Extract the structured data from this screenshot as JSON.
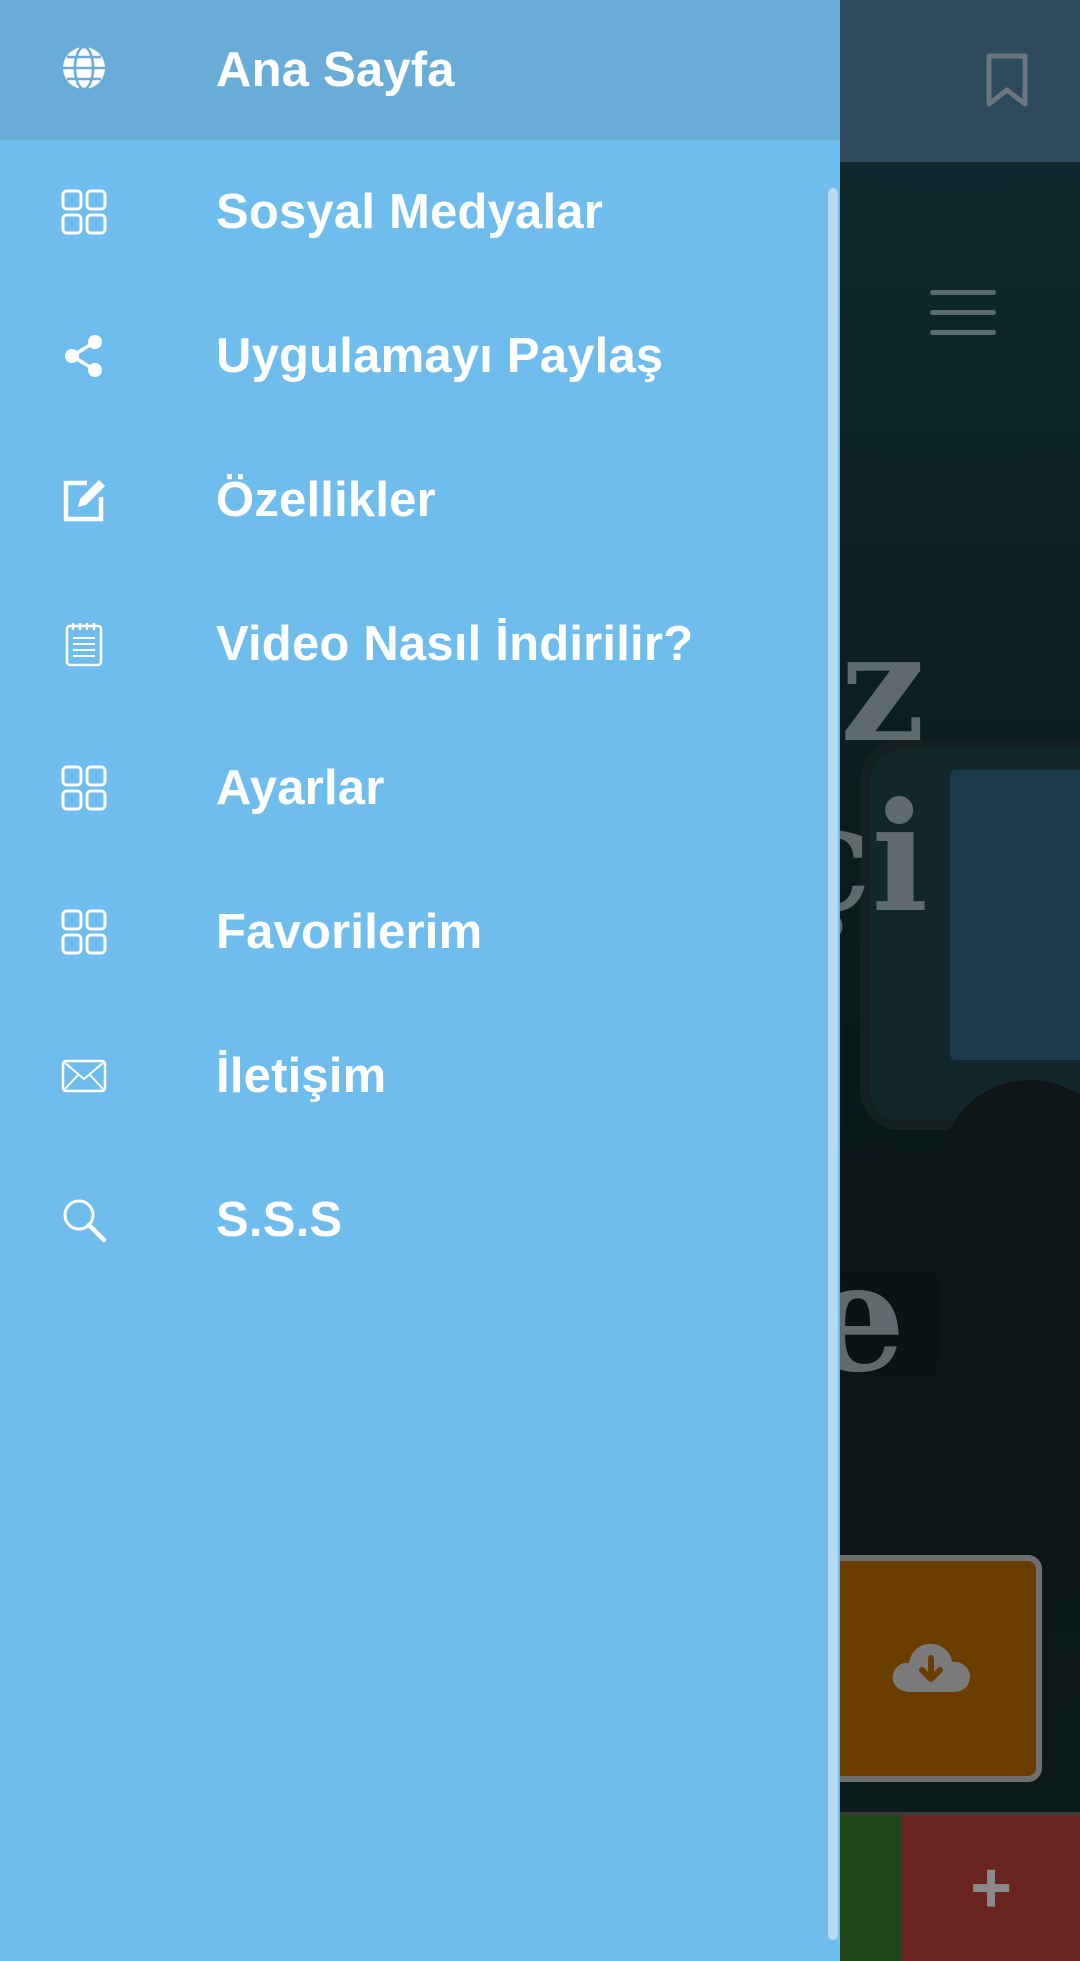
{
  "drawer": {
    "items": [
      {
        "label": "Ana Sayfa",
        "icon": "globe-icon",
        "active": true
      },
      {
        "label": "Sosyal Medyalar",
        "icon": "grid-icon",
        "active": false
      },
      {
        "label": "Uygulamayı Paylaş",
        "icon": "share-icon",
        "active": false
      },
      {
        "label": "Özellikler",
        "icon": "edit-icon",
        "active": false
      },
      {
        "label": "Video Nasıl İndirilir?",
        "icon": "notepad-icon",
        "active": false
      },
      {
        "label": "Ayarlar",
        "icon": "grid-icon",
        "active": false
      },
      {
        "label": "Favorilerim",
        "icon": "grid-icon",
        "active": false
      },
      {
        "label": "İletişim",
        "icon": "mail-icon",
        "active": false
      },
      {
        "label": "S.S.S",
        "icon": "search-icon",
        "active": false
      }
    ]
  },
  "background": {
    "hero_letters": [
      "z",
      "çi",
      "e"
    ],
    "bottom_bar_plus": "+"
  },
  "colors": {
    "drawer_bg": "#6fbded",
    "drawer_active_bg": "#68acd7",
    "drawer_text": "#ffffff",
    "download_button": "#6b3e00"
  }
}
